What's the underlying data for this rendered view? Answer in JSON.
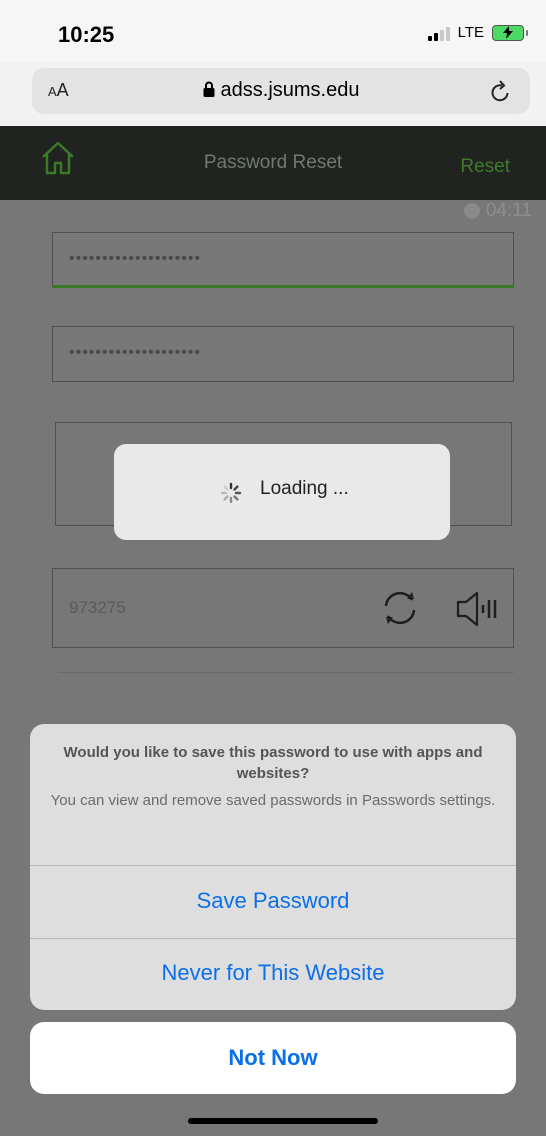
{
  "status_bar": {
    "time": "10:25",
    "network": "LTE"
  },
  "browser": {
    "text_size_label_small": "A",
    "text_size_label": "A",
    "url": "adss.jsums.edu"
  },
  "header": {
    "title": "Password Reset",
    "reset_label": "Reset"
  },
  "form": {
    "timer": "04:11",
    "password_masked": "••••••••••••••••••••",
    "confirm_masked": "••••••••••••••••••••",
    "captcha_code": "973275"
  },
  "loading": {
    "text": "Loading ..."
  },
  "save_sheet": {
    "title": "Would you like to save this password to use with apps and websites?",
    "message": "You can view and remove saved passwords in Passwords settings.",
    "save_label": "Save Password",
    "never_label": "Never for This Website",
    "cancel_label": "Not Now"
  },
  "colors": {
    "link_blue": "#0a6fe8",
    "accent_green": "#3b7a26",
    "header_bg": "#20231f"
  }
}
